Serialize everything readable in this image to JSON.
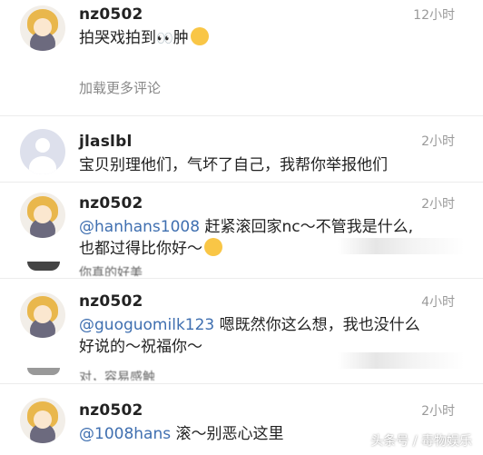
{
  "comments": [
    {
      "username": "nz0502",
      "time": "12小时",
      "text_before": "拍哭戏拍到",
      "text_after": "肿"
    },
    {
      "username": "jlaslbl",
      "time": "2小时",
      "text": "宝贝别理他们，气坏了自己，我帮你举报他们"
    },
    {
      "username": "nz0502",
      "time": "2小时",
      "mention": "@hanhans1008",
      "text_line1": " 赶紧滚回家nc～不管我是什么,",
      "text_line2": "也都过得比你好～"
    },
    {
      "username": "nz0502",
      "time": "4小时",
      "mention": "@guoguomilk123",
      "text_line1": " 嗯既然你这么想，我也没什么",
      "text_line2": "好说的～祝福你～"
    },
    {
      "username": "nz0502",
      "time": "2小时",
      "mention": "@1008hans",
      "text_line1": " 滚～别恶心这里"
    }
  ],
  "load_more": "加载更多评论",
  "overlap_text_1": "你真的好美",
  "overlap_text_2": "对，容易感触",
  "watermark": "头条号 / 毒物娱乐",
  "colors": {
    "mention": "#3f6fb0",
    "time": "#9a9a9a"
  },
  "icons": [
    "girl-avatar",
    "default-avatar",
    "eyes-emoji",
    "sad-face-emoji",
    "smile-emoji"
  ]
}
